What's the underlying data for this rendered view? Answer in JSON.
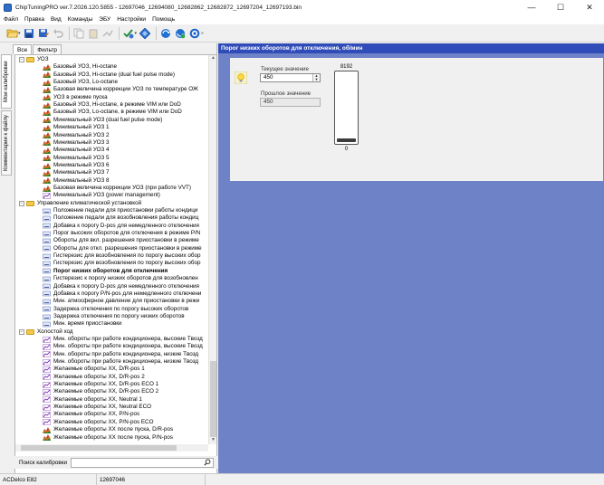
{
  "window": {
    "title": "ChipTuningPRO ver.7.2026.120.5855 - 12697046_12694080_12682862_12682872_12697204_12697193.bin",
    "minimize": "—",
    "maximize": "☐",
    "close": "✕"
  },
  "menu": [
    "Файл",
    "Правка",
    "Вид",
    "Команды",
    "ЭБУ",
    "Настройки",
    "Помощь"
  ],
  "toolbar": {
    "icons": [
      "open-folder-icon",
      "save-icon",
      "save-as-icon",
      "undo-icon",
      "copy-icon",
      "paste-icon",
      "compare-icon",
      "checksum-icon",
      "flash-icon",
      "read-ecu-icon",
      "write-ecu-icon",
      "help-icon"
    ]
  },
  "left": {
    "tab_all": "Все",
    "tab_filter": "Фильтр",
    "vtab_my": "Мои калибровки",
    "vtab_comments": "Комментарии к файлу",
    "tree": [
      {
        "type": "group",
        "label": "УОЗ",
        "level": 1
      },
      {
        "type": "map",
        "label": "Базовый УОЗ, Hi-octane"
      },
      {
        "type": "map",
        "label": "Базовый УОЗ, Hi-octane (dual fuel pulse mode)"
      },
      {
        "type": "map",
        "label": "Базовый УОЗ, Lo-octane"
      },
      {
        "type": "map",
        "label": "Базовая величина коррекции УОЗ по температуре ОЖ"
      },
      {
        "type": "map",
        "label": "УОЗ в режиме пуска"
      },
      {
        "type": "map",
        "label": "Базовый УОЗ, Hi-octane, в режиме VIM или DoD"
      },
      {
        "type": "map",
        "label": "Базовый УОЗ, Lo-octane, в режиме VIM или DoD"
      },
      {
        "type": "map",
        "label": "Минимальный УОЗ (dual fuel pulse mode)"
      },
      {
        "type": "map",
        "label": "Минимальный УОЗ 1"
      },
      {
        "type": "map",
        "label": "Минимальный УОЗ 2"
      },
      {
        "type": "map",
        "label": "Минимальный УОЗ 3"
      },
      {
        "type": "map",
        "label": "Минимальный УОЗ 4"
      },
      {
        "type": "map",
        "label": "Минимальный УОЗ 5"
      },
      {
        "type": "map",
        "label": "Минимальный УОЗ 6"
      },
      {
        "type": "map",
        "label": "Минимальный УОЗ 7"
      },
      {
        "type": "map",
        "label": "Минимальный УОЗ 8"
      },
      {
        "type": "map",
        "label": "Базовая величина коррекции УОЗ (при работе VVT)"
      },
      {
        "type": "curve",
        "label": "Минимальный УОЗ (power management)"
      },
      {
        "type": "group",
        "label": "Управление климатической установкой",
        "level": 1
      },
      {
        "type": "scalar",
        "label": "Положение педали для приостановки работы кондици"
      },
      {
        "type": "scalar",
        "label": "Положение педали для возобновления работы кондиц"
      },
      {
        "type": "scalar",
        "label": "Добавка к порогу D-pos для немедленного отключения"
      },
      {
        "type": "scalar",
        "label": "Порог высоких оборотов для отключения в режиме P/N"
      },
      {
        "type": "scalar",
        "label": "Обороты для вкл. разрешения приостановки в режиме"
      },
      {
        "type": "scalar",
        "label": "Обороты для откл. разрешения приостановки в режиме"
      },
      {
        "type": "scalar",
        "label": "Гистерезис для возобновления по порогу высоких обор"
      },
      {
        "type": "scalar",
        "label": "Гистерезис для возобновления по порогу высоких обор"
      },
      {
        "type": "scalar",
        "label": "Порог низких оборотов для отключения",
        "selected": true
      },
      {
        "type": "scalar",
        "label": "Гистерезис к порогу низких оборотов для возобновлен"
      },
      {
        "type": "scalar",
        "label": "Добавка к порогу D-pos для немедленного отключения"
      },
      {
        "type": "scalar",
        "label": "Добавка к порогу P/N-pos для немедленного отключени"
      },
      {
        "type": "scalar",
        "label": "Мин. атмосферное давление для приостановки в режи"
      },
      {
        "type": "scalar",
        "label": "Задержка отключения по порогу высоких оборотов"
      },
      {
        "type": "scalar",
        "label": "Задержка отключения по порогу низких оборотов"
      },
      {
        "type": "scalar",
        "label": "Мин. время приостановки"
      },
      {
        "type": "group",
        "label": "Холостой ход",
        "level": 1
      },
      {
        "type": "curve",
        "label": "Мин. обороты при работе кондиционера, высокие Tвозд"
      },
      {
        "type": "curve",
        "label": "Мин. обороты при работе кондиционера, высокие Tвозд"
      },
      {
        "type": "curve",
        "label": "Мин. обороты при работе кондиционера, низкие Tвозд"
      },
      {
        "type": "curve",
        "label": "Мин. обороты при работе кондиционера, низкие Tвозд"
      },
      {
        "type": "curve",
        "label": "Желаемые обороты XX, D/R-pos 1"
      },
      {
        "type": "curve",
        "label": "Желаемые обороты XX, D/R-pos 2"
      },
      {
        "type": "curve",
        "label": "Желаемые обороты XX, D/R-pos ECO 1"
      },
      {
        "type": "curve",
        "label": "Желаемые обороты XX, D/R-pos ECO 2"
      },
      {
        "type": "curve",
        "label": "Желаемые обороты XX, Neutral 1"
      },
      {
        "type": "curve",
        "label": "Желаемые обороты XX, Neutral ECO"
      },
      {
        "type": "curve",
        "label": "Желаемые обороты XX, P/N-pos"
      },
      {
        "type": "curve",
        "label": "Желаемые обороты XX, P/N-pos ECO"
      },
      {
        "type": "map",
        "label": "Желаемые обороты XX после пуска, D/R-pos"
      },
      {
        "type": "map",
        "label": "Желаемые обороты XX после пуска, P/N-pos"
      }
    ],
    "search_label": "Поиск калибровки",
    "search_value": ""
  },
  "param": {
    "header": "Порог низких оборотов для отключения, об/мин",
    "current_label": "Текущее значение",
    "current_value": "450",
    "previous_label": "Прошлое значение",
    "previous_value": "450",
    "gauge_max": "8192",
    "gauge_min": "0",
    "gauge_fraction": 0.055
  },
  "status": {
    "ecu": "ACDelco E82",
    "id": "12697046"
  }
}
